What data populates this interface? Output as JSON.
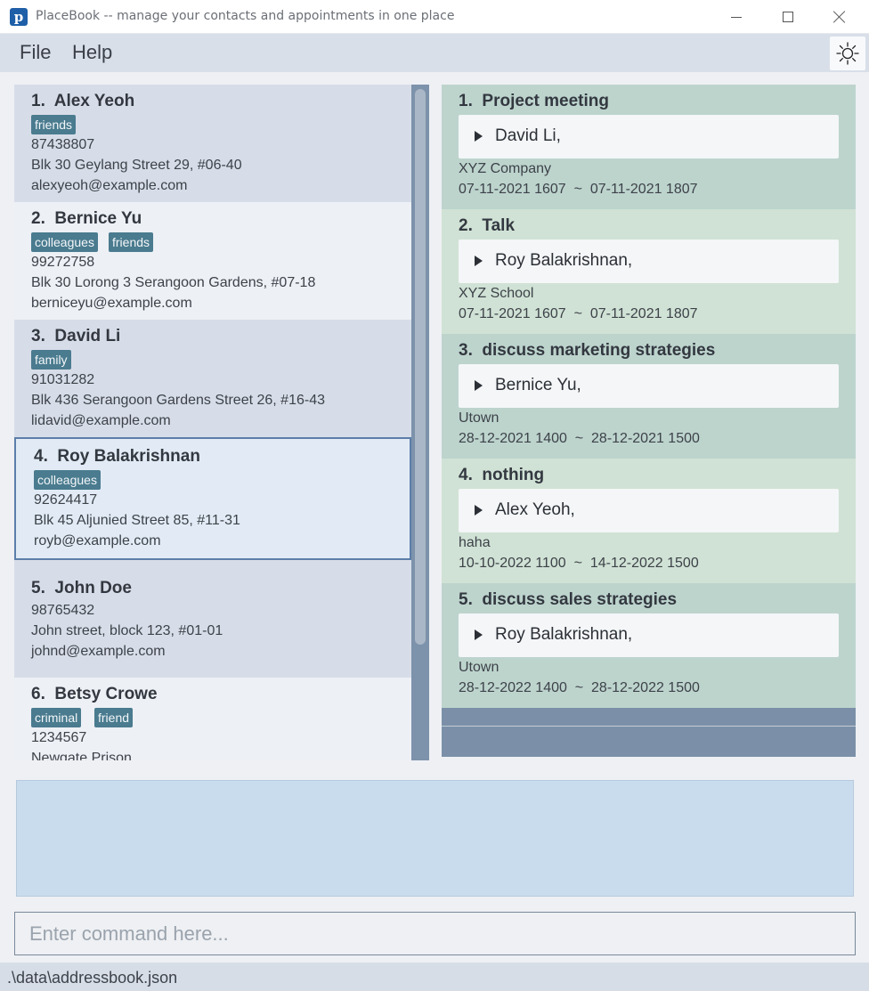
{
  "window": {
    "title": "PlaceBook -- manage your contacts and appointments in one place",
    "logo_letter": "p"
  },
  "menu": {
    "file": "File",
    "help": "Help"
  },
  "icons": {
    "theme_toggle": "sun-icon",
    "appt_expand": "triangle-right-icon"
  },
  "colors": {
    "tag_bg": "#4a7b8f",
    "selected_border": "#5c7ea9",
    "appt_card_a": "#bdd4cd",
    "appt_card_b": "#d0e2d5",
    "result_bg": "#c9dcee"
  },
  "persons": [
    {
      "index": "1.",
      "name": "Alex Yeoh",
      "tags": [
        "friends"
      ],
      "phone": "87438807",
      "address": "Blk 30 Geylang Street 29, #06-40",
      "email": "alexyeoh@example.com"
    },
    {
      "index": "2.",
      "name": "Bernice Yu",
      "tags": [
        "colleagues",
        "friends"
      ],
      "phone": "99272758",
      "address": "Blk 30 Lorong 3 Serangoon Gardens, #07-18",
      "email": "berniceyu@example.com"
    },
    {
      "index": "3.",
      "name": "David Li",
      "tags": [
        "family"
      ],
      "phone": "91031282",
      "address": "Blk 436 Serangoon Gardens Street 26, #16-43",
      "email": "lidavid@example.com"
    },
    {
      "index": "4.",
      "name": "Roy Balakrishnan",
      "tags": [
        "colleagues"
      ],
      "phone": "92624417",
      "address": "Blk 45 Aljunied Street 85, #11-31",
      "email": "royb@example.com",
      "selected": true
    },
    {
      "index": "5.",
      "name": "John Doe",
      "tags": [],
      "phone": "98765432",
      "address": "John street, block 123, #01-01",
      "email": "johnd@example.com"
    },
    {
      "index": "6.",
      "name": "Betsy Crowe",
      "tags": [
        "criminal",
        "friend"
      ],
      "phone": "1234567",
      "address": "Newgate Prison"
    }
  ],
  "appointments": [
    {
      "index": "1.",
      "title": "Project meeting",
      "persons": "David Li,",
      "location": "XYZ Company",
      "start": "07-11-2021 1607",
      "sep": "~",
      "end": "07-11-2021 1807"
    },
    {
      "index": "2.",
      "title": "Talk",
      "persons": "Roy Balakrishnan,",
      "location": "XYZ School",
      "start": "07-11-2021 1607",
      "sep": "~",
      "end": "07-11-2021 1807"
    },
    {
      "index": "3.",
      "title": "discuss marketing strategies",
      "persons": "Bernice Yu,",
      "location": "Utown",
      "start": "28-12-2021 1400",
      "sep": "~",
      "end": "28-12-2021 1500"
    },
    {
      "index": "4.",
      "title": "nothing",
      "persons": "Alex Yeoh,",
      "location": "haha",
      "start": "10-10-2022 1100",
      "sep": "~",
      "end": "14-12-2022 1500"
    },
    {
      "index": "5.",
      "title": "discuss sales strategies",
      "persons": "Roy Balakrishnan,",
      "location": "Utown",
      "start": "28-12-2022 1400",
      "sep": "~",
      "end": "28-12-2022 1500"
    }
  ],
  "result_display": "",
  "command": {
    "placeholder": "Enter command here...",
    "value": ""
  },
  "status": {
    "save_path": ".\\data\\addressbook.json"
  }
}
